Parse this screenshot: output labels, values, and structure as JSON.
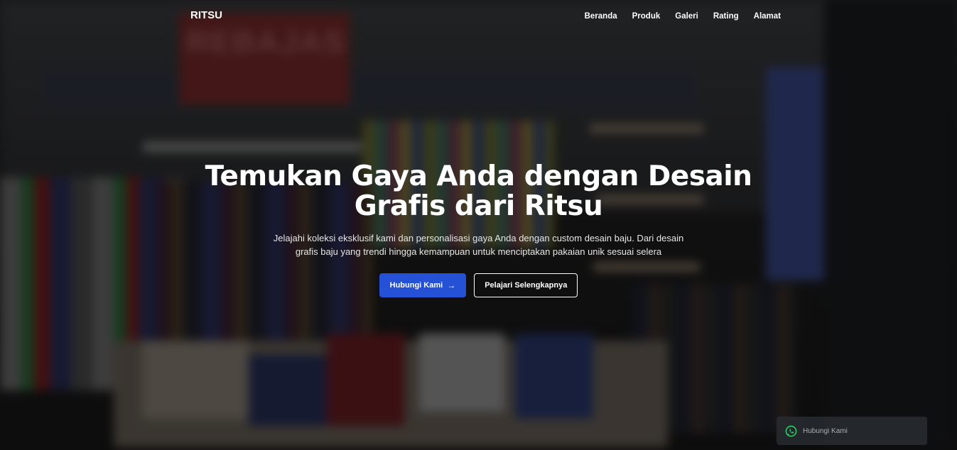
{
  "nav": {
    "logo": "RITSU",
    "items": [
      {
        "label": "Beranda"
      },
      {
        "label": "Produk"
      },
      {
        "label": "Galeri"
      },
      {
        "label": "Rating"
      },
      {
        "label": "Alamat"
      }
    ]
  },
  "hero": {
    "title": "Temukan Gaya Anda dengan Desain Grafis dari Ritsu",
    "subtitle": "Jelajahi koleksi eksklusif kami dan personalisasi gaya Anda dengan custom desain baju. Dari desain grafis baju yang trendi hingga kemampuan untuk menciptakan pakaian unik sesuai selera",
    "primary_button": "Hubungi Kami",
    "primary_icon": "→",
    "secondary_button": "Pelajari Selengkapnya",
    "background_sign": "REBAJAS"
  },
  "whatsapp": {
    "label": "Hubungi Kami",
    "icon": "whatsapp-icon"
  },
  "colors": {
    "primary": "#2451d6",
    "whatsapp": "#25d366"
  }
}
